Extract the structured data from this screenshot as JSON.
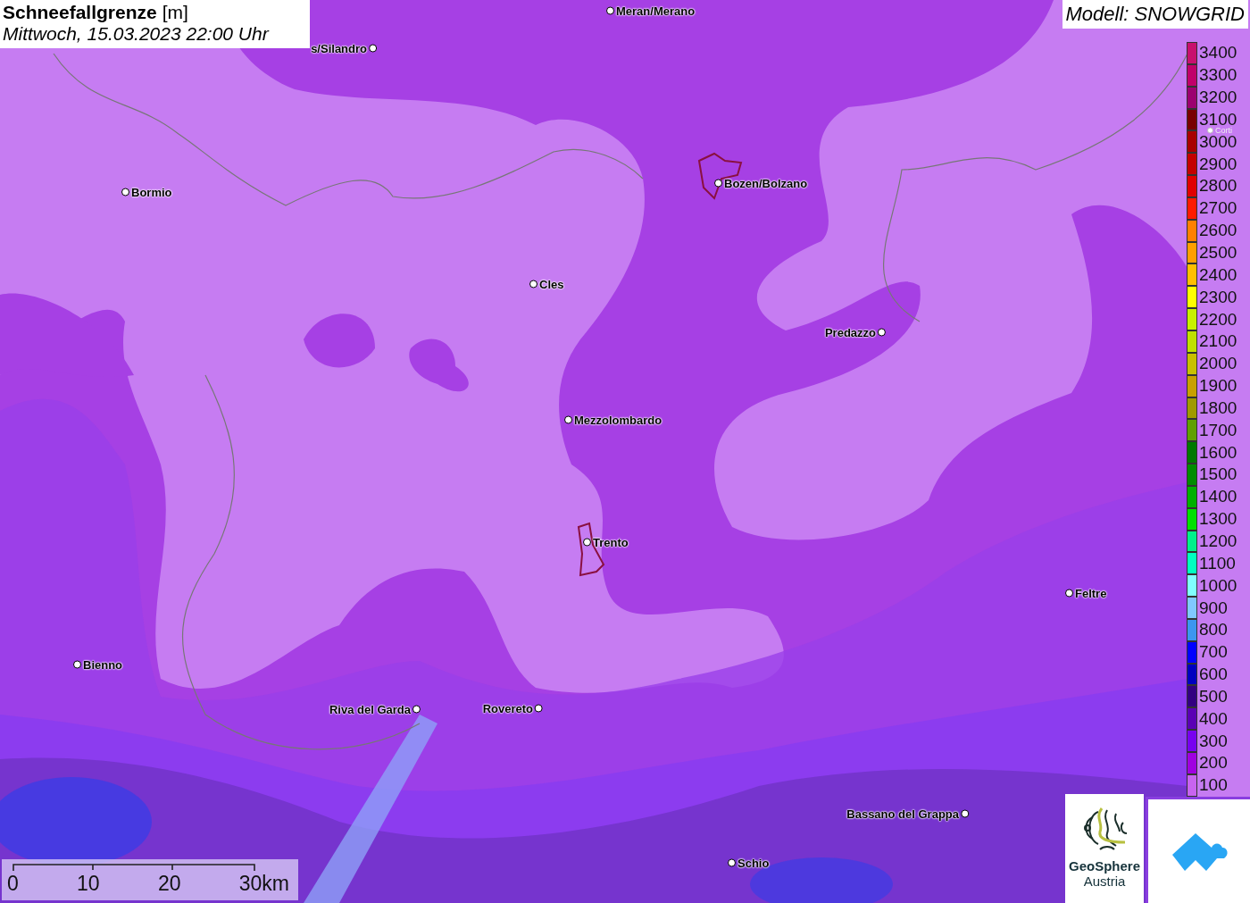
{
  "title": {
    "parameter": "Schneefallgrenze",
    "unit": "[m]",
    "datetime": "Mittwoch, 15.03.2023 22:00 Uhr"
  },
  "model": "Modell: SNOWGRID",
  "legend": [
    {
      "label": "3400",
      "color": "#c8106e"
    },
    {
      "label": "3300",
      "color": "#c0006a"
    },
    {
      "label": "3200",
      "color": "#9c0070"
    },
    {
      "label": "3100",
      "color": "#780000"
    },
    {
      "label": "3000",
      "color": "#a80000"
    },
    {
      "label": "2900",
      "color": "#c40000"
    },
    {
      "label": "2800",
      "color": "#e00000"
    },
    {
      "label": "2700",
      "color": "#ff1a00"
    },
    {
      "label": "2600",
      "color": "#ff8000"
    },
    {
      "label": "2500",
      "color": "#ff9f00"
    },
    {
      "label": "2400",
      "color": "#ffbf00"
    },
    {
      "label": "2300",
      "color": "#ffff00"
    },
    {
      "label": "2200",
      "color": "#c8f000"
    },
    {
      "label": "2100",
      "color": "#c0e000"
    },
    {
      "label": "2000",
      "color": "#c8c000"
    },
    {
      "label": "1900",
      "color": "#c8a000"
    },
    {
      "label": "1800",
      "color": "#a09a00"
    },
    {
      "label": "1700",
      "color": "#60a000"
    },
    {
      "label": "1600",
      "color": "#007800"
    },
    {
      "label": "1500",
      "color": "#008c00"
    },
    {
      "label": "1400",
      "color": "#00b000"
    },
    {
      "label": "1300",
      "color": "#00e000"
    },
    {
      "label": "1200",
      "color": "#00f08c"
    },
    {
      "label": "1100",
      "color": "#00ffc0"
    },
    {
      "label": "1000",
      "color": "#80ffff"
    },
    {
      "label": "900",
      "color": "#80c8ff"
    },
    {
      "label": "800",
      "color": "#3c96f0"
    },
    {
      "label": "700",
      "color": "#0000ff"
    },
    {
      "label": "600",
      "color": "#0000c0"
    },
    {
      "label": "500",
      "color": "#320080"
    },
    {
      "label": "400",
      "color": "#5a00b4"
    },
    {
      "label": "300",
      "color": "#7800f0"
    },
    {
      "label": "200",
      "color": "#a000e0"
    },
    {
      "label": "100",
      "color": "#c864f0"
    }
  ],
  "places": [
    {
      "label": "Meran/Merano"
    },
    {
      "label": "s/Silandro"
    },
    {
      "label": "Bormio"
    },
    {
      "label": "Bozen/Bolzano"
    },
    {
      "label": "Cles"
    },
    {
      "label": "Predazzo"
    },
    {
      "label": "Mezzolombardo"
    },
    {
      "label": "Trento"
    },
    {
      "label": "Feltre"
    },
    {
      "label": "Bienno"
    },
    {
      "label": "Riva del Garda"
    },
    {
      "label": "Rovereto"
    },
    {
      "label": "Bassano del Grappa"
    },
    {
      "label": "Schio"
    },
    {
      "label": "Corti"
    }
  ],
  "scale_bar": {
    "labels": [
      "0",
      "10",
      "20",
      "30km"
    ]
  },
  "logo": {
    "name": "GeoSphere",
    "subtitle": "Austria"
  }
}
